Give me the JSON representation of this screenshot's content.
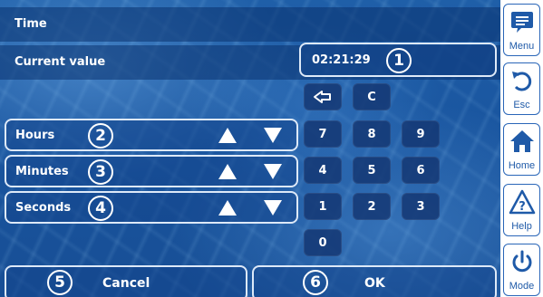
{
  "title": "Time",
  "current_value": {
    "label": "Current value",
    "value": "02:21:29",
    "marker": "1"
  },
  "fields": [
    {
      "label": "Hours",
      "marker": "2"
    },
    {
      "label": "Minutes",
      "marker": "3"
    },
    {
      "label": "Seconds",
      "marker": "4"
    }
  ],
  "keypad": {
    "clear": "C",
    "keys": [
      "7",
      "8",
      "9",
      "4",
      "5",
      "6",
      "1",
      "2",
      "3",
      "0"
    ]
  },
  "footer": {
    "cancel": {
      "label": "Cancel",
      "marker": "5"
    },
    "ok": {
      "label": "OK",
      "marker": "6"
    }
  },
  "sidebar": [
    {
      "label": "Menu",
      "icon": "menu-icon"
    },
    {
      "label": "Esc",
      "icon": "undo-icon"
    },
    {
      "label": "Home",
      "icon": "home-icon"
    },
    {
      "label": "Help",
      "icon": "help-icon"
    },
    {
      "label": "Mode",
      "icon": "power-icon"
    }
  ],
  "colors": {
    "accent": "#1f5aa8",
    "panel": "#1a56a0",
    "sidebar": "#ffffff"
  }
}
